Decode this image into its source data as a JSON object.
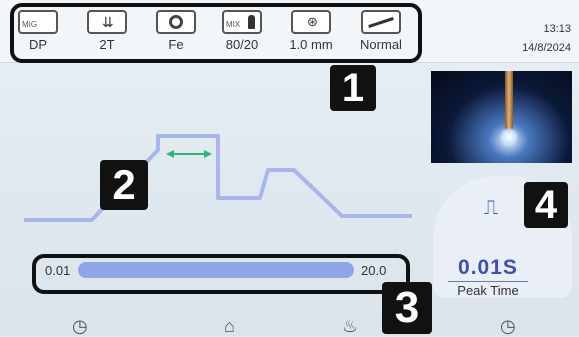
{
  "header": {
    "settings": [
      {
        "id": "process",
        "icon": "mig-torch-icon",
        "icon_label": "MIG",
        "value": "DP"
      },
      {
        "id": "trigger",
        "icon": "trigger-mode-icon",
        "value": "2T"
      },
      {
        "id": "material",
        "icon": "wire-spool-icon",
        "value": "Fe"
      },
      {
        "id": "gas",
        "icon": "gas-cylinder-icon",
        "icon_label": "MIX",
        "value": "80/20"
      },
      {
        "id": "wire",
        "icon": "wire-diameter-icon",
        "value": "1.0 mm"
      },
      {
        "id": "mode",
        "icon": "torch-mode-icon",
        "value": "Normal"
      }
    ],
    "time": "13:13",
    "date": "14/8/2024"
  },
  "callouts": [
    "1",
    "2",
    "3",
    "4"
  ],
  "slider": {
    "min_label": "0.01",
    "max_label": "20.0",
    "level_fraction": 0.0
  },
  "parameter": {
    "icon": "peak-time-icon",
    "value": "0.01S",
    "label": "Peak Time"
  },
  "bottom_nav": [
    "gauge-icon",
    "home-icon",
    "welder-icon",
    "gauge-right-icon"
  ],
  "colors": {
    "accent": "#3d4fb5",
    "wave": "#a9b6ee",
    "highlight_arrow": "#2bb673",
    "slider": "#8fa6e8"
  }
}
